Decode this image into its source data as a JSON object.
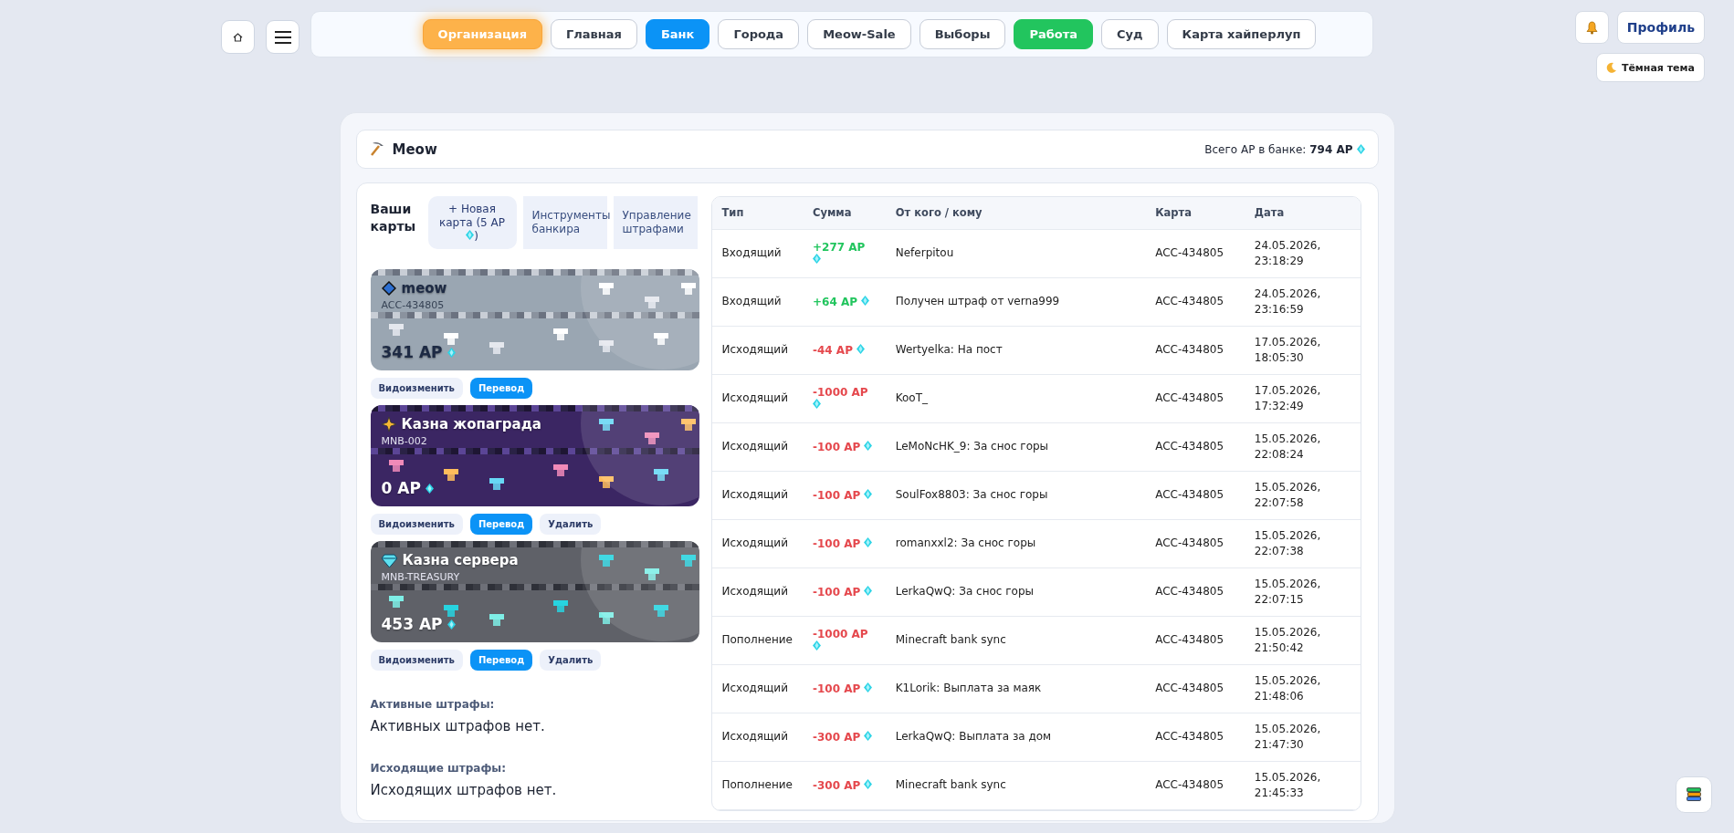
{
  "nav": {
    "items": [
      {
        "label": "Организация",
        "kind": "orange"
      },
      {
        "label": "Главная",
        "kind": "plain"
      },
      {
        "label": "Банк",
        "kind": "blue"
      },
      {
        "label": "Города",
        "kind": "plain"
      },
      {
        "label": "Meow-Sale",
        "kind": "plain"
      },
      {
        "label": "Выборы",
        "kind": "plain"
      },
      {
        "label": "Работа",
        "kind": "green"
      },
      {
        "label": "Суд",
        "kind": "plain"
      },
      {
        "label": "Карта хайперлуп",
        "kind": "plain"
      }
    ]
  },
  "user": {
    "profile": "Профиль",
    "theme": "Тёмная тема"
  },
  "bank": {
    "name": "Meow",
    "total_label": "Всего AP в банке:",
    "total": "794 AP"
  },
  "cards_title": "Ваши карты",
  "card_actions": [
    {
      "before": "+ Новая карта (5 AP",
      "after": ")",
      "kind": "new"
    },
    {
      "before": "Инструменты банкира",
      "kind": "tool"
    },
    {
      "before": "Управление штрафами",
      "kind": "tool"
    }
  ],
  "cards": [
    {
      "name": "meow",
      "number": "ACC-434805",
      "balance": "341 AP",
      "kind": "plain",
      "color": "#9aa6b2",
      "buttons": [
        {
          "label": "Видоизменить",
          "kind": "secondary"
        },
        {
          "label": "Перевод",
          "kind": "primary"
        }
      ]
    },
    {
      "name": "Казна жопаграда",
      "number": "MNB-002",
      "balance": "0 AP",
      "kind": "purple",
      "color": "#3b2663",
      "buttons": [
        {
          "label": "Видоизменить",
          "kind": "secondary"
        },
        {
          "label": "Перевод",
          "kind": "primary"
        },
        {
          "label": "Удалить",
          "kind": "secondary"
        }
      ]
    },
    {
      "name": "Казна сервера",
      "number": "MNB-TREASURY",
      "balance": "453 AP",
      "kind": "server",
      "color": "#5f6168",
      "buttons": [
        {
          "label": "Видоизменить",
          "kind": "secondary"
        },
        {
          "label": "Перевод",
          "kind": "primary"
        },
        {
          "label": "Удалить",
          "kind": "secondary"
        }
      ]
    }
  ],
  "fines": [
    {
      "title": "Активные штрафы:",
      "text": "Активных штрафов нет."
    },
    {
      "title": "Исходящие штрафы:",
      "text": "Исходящих штрафов нет."
    }
  ],
  "table": {
    "columns": [
      "Тип",
      "Сумма",
      "От кого / кому",
      "Карта",
      "Дата"
    ],
    "rows": [
      {
        "type": "Входящий",
        "amount": "+277 AP",
        "kind": "credit",
        "party": "Neferpitou",
        "card": "ACC-434805",
        "date": "24.05.2026, 23:18:29"
      },
      {
        "type": "Входящий",
        "amount": "+64 AP",
        "kind": "credit",
        "party": "Получен штраф от verna999",
        "card": "ACC-434805",
        "date": "24.05.2026, 23:16:59"
      },
      {
        "type": "Исходящий",
        "amount": "-44 AP",
        "kind": "debit",
        "party": "Wertyelka: На пост",
        "card": "ACC-434805",
        "date": "17.05.2026, 18:05:30"
      },
      {
        "type": "Исходящий",
        "amount": "-1000 AP",
        "kind": "debit",
        "party": "KooT_",
        "card": "ACC-434805",
        "date": "17.05.2026, 17:32:49"
      },
      {
        "type": "Исходящий",
        "amount": "-100 AP",
        "kind": "debit",
        "party": "LeMoNcHK_9: За снос горы",
        "card": "ACC-434805",
        "date": "15.05.2026, 22:08:24"
      },
      {
        "type": "Исходящий",
        "amount": "-100 AP",
        "kind": "debit",
        "party": "SoulFox8803: За снос горы",
        "card": "ACC-434805",
        "date": "15.05.2026, 22:07:58"
      },
      {
        "type": "Исходящий",
        "amount": "-100 AP",
        "kind": "debit",
        "party": "romanxxl2: За снос горы",
        "card": "ACC-434805",
        "date": "15.05.2026, 22:07:38"
      },
      {
        "type": "Исходящий",
        "amount": "-100 AP",
        "kind": "debit",
        "party": "LerkaQwQ: За снос горы",
        "card": "ACC-434805",
        "date": "15.05.2026, 22:07:15"
      },
      {
        "type": "Пополнение",
        "amount": "-1000 AP",
        "kind": "debit",
        "party": "Minecraft bank sync",
        "card": "ACC-434805",
        "date": "15.05.2026, 21:50:42"
      },
      {
        "type": "Исходящий",
        "amount": "-100 AP",
        "kind": "debit",
        "party": "K1Lorik: Выплата за маяк",
        "card": "ACC-434805",
        "date": "15.05.2026, 21:48:06"
      },
      {
        "type": "Исходящий",
        "amount": "-300 AP",
        "kind": "debit",
        "party": "LerkaQwQ: Выплата за дом",
        "card": "ACC-434805",
        "date": "15.05.2026, 21:47:30"
      },
      {
        "type": "Пополнение",
        "amount": "-300 AP",
        "kind": "debit",
        "party": "Minecraft bank sync",
        "card": "ACC-434805",
        "date": "15.05.2026, 21:45:33"
      }
    ]
  }
}
